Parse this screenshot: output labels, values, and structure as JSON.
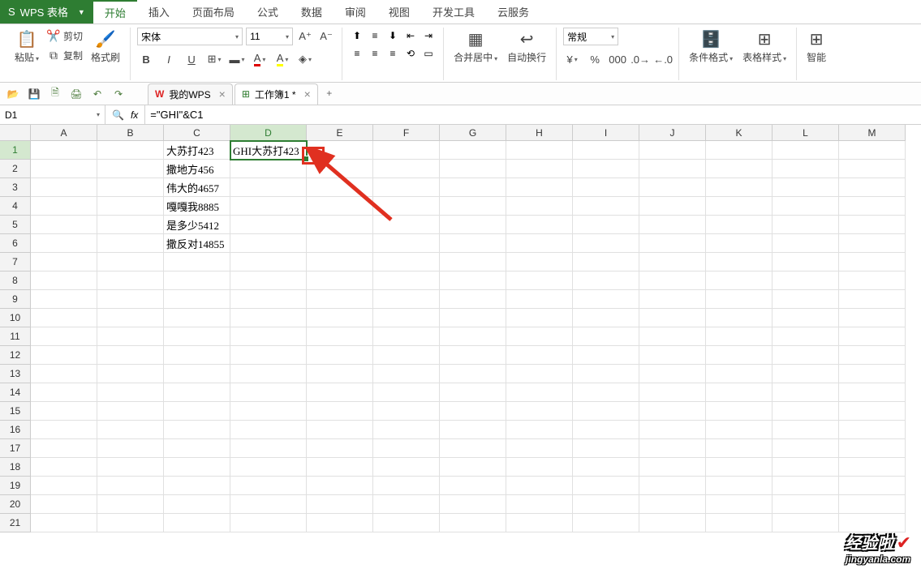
{
  "app": {
    "name": "WPS 表格"
  },
  "menu": {
    "tabs": [
      "开始",
      "插入",
      "页面布局",
      "公式",
      "数据",
      "审阅",
      "视图",
      "开发工具",
      "云服务"
    ],
    "active": 0
  },
  "ribbon": {
    "clipboard": {
      "paste": "粘贴",
      "cut": "剪切",
      "copy": "复制",
      "format_painter": "格式刷"
    },
    "font": {
      "name": "宋体",
      "size": "11",
      "bold": "B",
      "italic": "I",
      "underline": "U"
    },
    "alignment": {
      "merge_center": "合并居中",
      "wrap": "自动换行"
    },
    "number": {
      "format": "常规"
    },
    "styles": {
      "conditional": "条件格式",
      "table_style": "表格样式"
    },
    "cells": {
      "smart": "智能"
    }
  },
  "doc_tabs": [
    {
      "icon": "wps",
      "label": "我的WPS",
      "active": false
    },
    {
      "icon": "sheet",
      "label": "工作簿1 *",
      "active": true
    }
  ],
  "formula_bar": {
    "name_box": "D1",
    "fx": "fx",
    "formula": "=\"GHI\"&C1"
  },
  "columns": [
    "A",
    "B",
    "C",
    "D",
    "E",
    "F",
    "G",
    "H",
    "I",
    "J",
    "K",
    "L",
    "M"
  ],
  "selected_cell": {
    "row": 1,
    "col": "D"
  },
  "cells": {
    "C1": "大苏打423",
    "C2": "撒地方456",
    "C3": "伟大的4657",
    "C4": "嘎嘎我8885",
    "C5": "是多少5412",
    "C6": "撒反对14855",
    "D1": "GHI大苏打423"
  },
  "row_count": 21,
  "watermark": {
    "line1": "经验啦",
    "line2": "jingyanla.com"
  },
  "chart_data": null
}
